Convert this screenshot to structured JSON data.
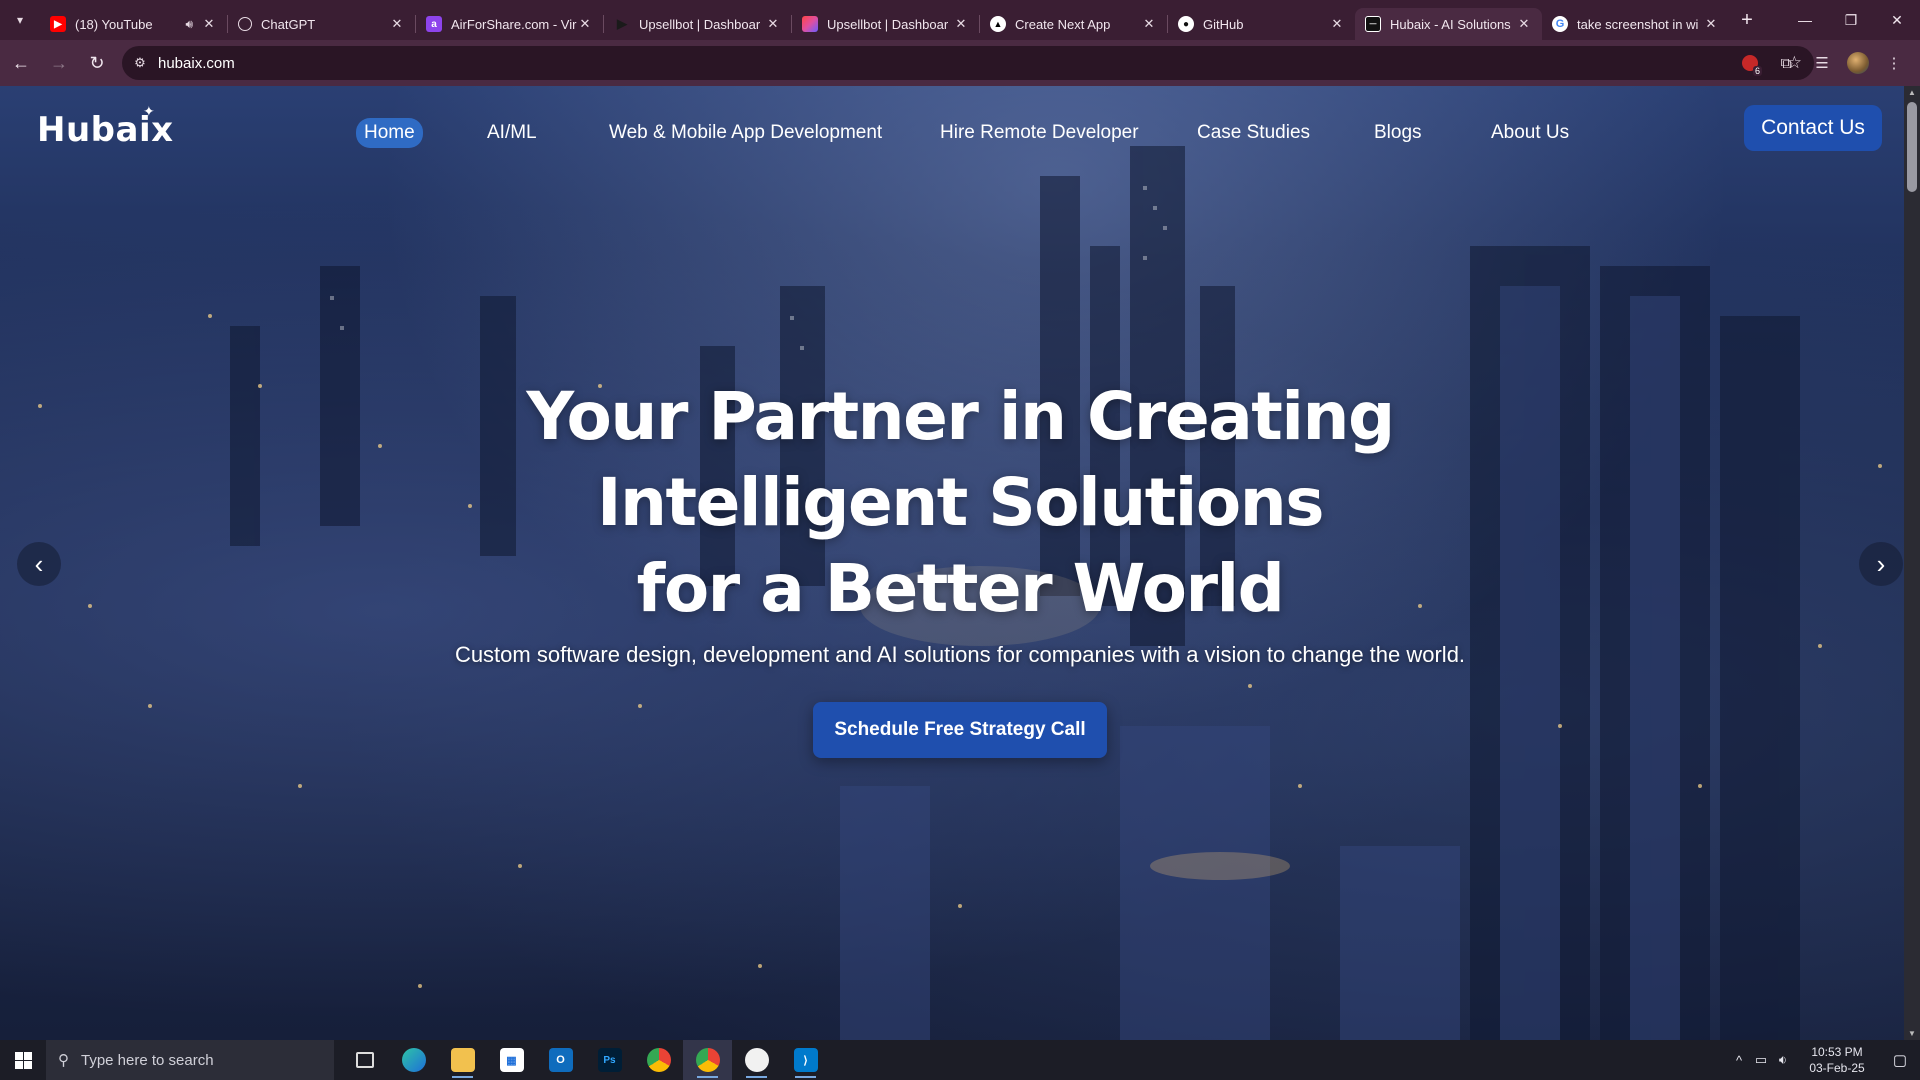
{
  "browser": {
    "tabs": [
      {
        "title": "(18) YouTube",
        "icon": "youtube-icon",
        "color": "#ff0000",
        "audio": true
      },
      {
        "title": "ChatGPT",
        "icon": "chatgpt-icon",
        "color": "#3a1e33"
      },
      {
        "title": "AirForShare.com - Vir",
        "icon": "airforshare-icon",
        "color": "#8e44ec"
      },
      {
        "title": "Upsellbot | Dashboar",
        "icon": "upsellbot-icon",
        "color": "#3a1e33"
      },
      {
        "title": "Upsellbot | Dashboar",
        "icon": "upsellbot-color-icon",
        "color": "#e04fa0"
      },
      {
        "title": "Create Next App",
        "icon": "nextjs-icon",
        "color": "#000000"
      },
      {
        "title": "GitHub",
        "icon": "github-icon",
        "color": "#3a1e33"
      },
      {
        "title": "Hubaix - AI Solutions",
        "icon": "hubaix-icon",
        "color": "#ffffff",
        "active": true
      },
      {
        "title": "take screenshot in wi",
        "icon": "google-icon",
        "color": "#ffffff"
      }
    ],
    "url": "hubaix.com",
    "extension_badge": "6"
  },
  "site": {
    "logo": "Hubaix",
    "logo_spark": "✦",
    "nav": {
      "home": "Home",
      "aiml": "AI/ML",
      "webmobile": "Web & Mobile App Development",
      "hire": "Hire Remote Developer",
      "cases": "Case Studies",
      "blogs": "Blogs",
      "about": "About Us"
    },
    "contact": "Contact Us",
    "hero": {
      "line1": "Your Partner in Creating",
      "line2": "Intelligent Solutions",
      "line3": "for a Better World",
      "subtitle": "Custom software design, development and AI solutions for companies with a vision to change the world.",
      "cta": "Schedule Free Strategy Call"
    }
  },
  "taskbar": {
    "search_placeholder": "Type here to search",
    "time": "10:53 PM",
    "date": "03-Feb-25"
  },
  "colors": {
    "accent": "#1f4fae",
    "tab_strip": "#3a1e33",
    "toolbar": "#4a2a42",
    "hero_overlay": "#1d2b50"
  }
}
